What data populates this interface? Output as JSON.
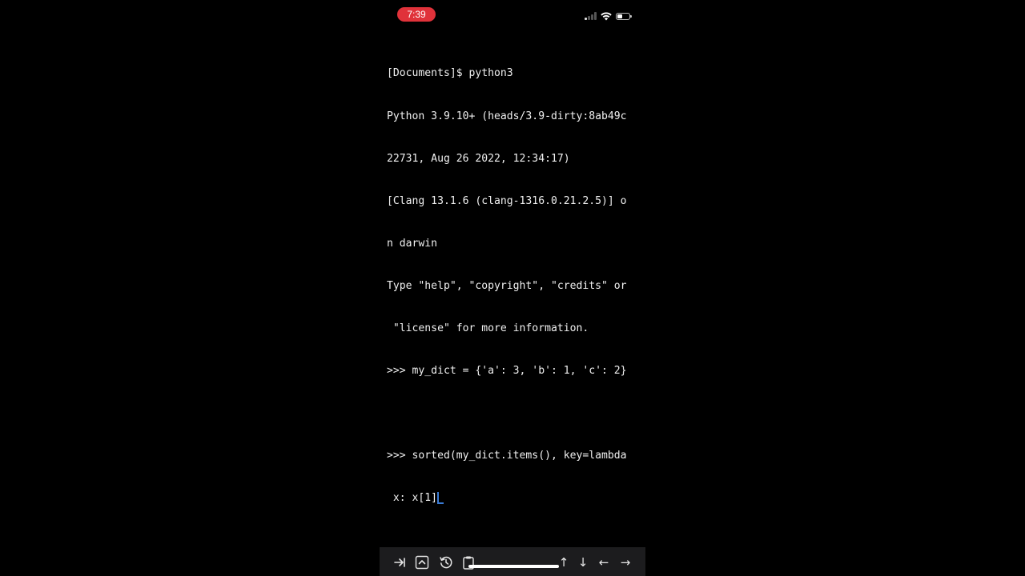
{
  "status_bar": {
    "time": "7:39",
    "icons": [
      "cellular-signal-icon",
      "wifi-icon",
      "battery-icon"
    ],
    "battery_level": 0.45,
    "time_pill_color": "#e0323a"
  },
  "terminal": {
    "lines": [
      "[Documents]$ python3",
      "Python 3.9.10+ (heads/3.9-dirty:8ab49c",
      "22731, Aug 26 2022, 12:34:17)",
      "[Clang 13.1.6 (clang-1316.0.21.2.5)] o",
      "n darwin",
      "Type \"help\", \"copyright\", \"credits\" or",
      " \"license\" for more information.",
      ">>> my_dict = {'a': 3, 'b': 1, 'c': 2}",
      "",
      ">>> sorted(my_dict.items(), key=lambda",
      " x: x[1]"
    ],
    "cursor_color": "#3a7bd5"
  },
  "toolbar": {
    "buttons": [
      {
        "icon": "tab-key-icon"
      },
      {
        "icon": "ctrl-key-icon"
      },
      {
        "icon": "history-icon"
      },
      {
        "icon": "paste-icon"
      },
      {
        "icon": "arrow-up-icon",
        "glyph": "↑"
      },
      {
        "icon": "arrow-down-icon",
        "glyph": "↓"
      },
      {
        "icon": "arrow-left-icon",
        "glyph": "←"
      },
      {
        "icon": "arrow-right-icon",
        "glyph": "→"
      }
    ]
  }
}
